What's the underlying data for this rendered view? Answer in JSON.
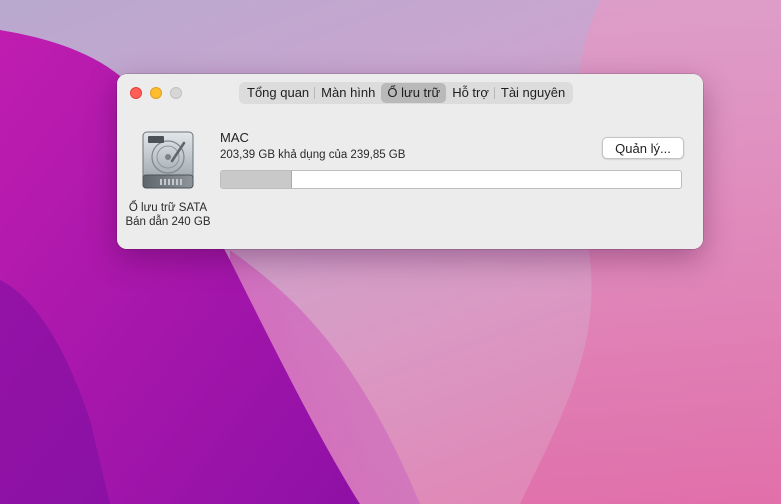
{
  "window": {
    "tabs": [
      {
        "label": "Tổng quan"
      },
      {
        "label": "Màn hình"
      },
      {
        "label": "Ổ lưu trữ"
      },
      {
        "label": "Hỗ trợ"
      },
      {
        "label": "Tài nguyên"
      }
    ],
    "active_tab": "Ổ lưu trữ"
  },
  "disk": {
    "icon": "hard-drive-icon",
    "caption_line1": "Ổ lưu trữ SATA",
    "caption_line2": "Bán dẫn 240 GB"
  },
  "volume": {
    "name": "MAC",
    "available_text": "203,39 GB khả dụng của 239,85 GB",
    "used_fraction": 0.152,
    "manage_label": "Quản lý..."
  },
  "colors": {
    "close": "#ff5f57",
    "minimize": "#febc2e",
    "zoom": "#d7d6d6",
    "wallpaper_magenta": "#b513a8",
    "wallpaper_pink": "#e47fb0"
  }
}
